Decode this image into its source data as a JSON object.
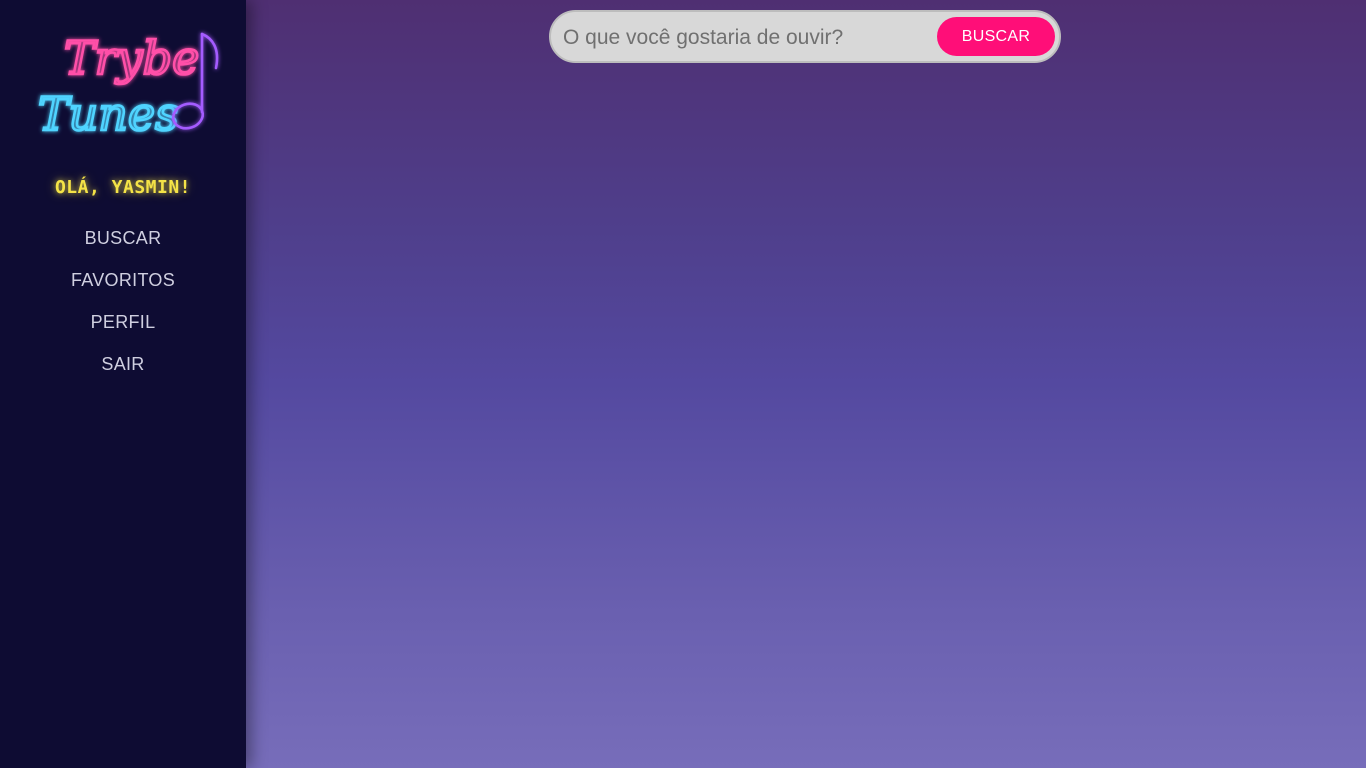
{
  "app": {
    "logo_text_line1": "Trybe",
    "logo_text_line2": "Tunes",
    "logo_colors": {
      "pink": "#ff4fa8",
      "cyan": "#4fd4ff",
      "violet": "#a45bff"
    }
  },
  "sidebar": {
    "greeting": "OLÁ, YASMIN!",
    "items": [
      {
        "label": "BUSCAR"
      },
      {
        "label": "FAVORITOS"
      },
      {
        "label": "PERFIL"
      },
      {
        "label": "SAIR"
      }
    ]
  },
  "search": {
    "placeholder": "O que você gostaria de ouvir?",
    "value": "",
    "button_label": "BUSCAR"
  },
  "colors": {
    "sidebar_bg": "#0e0c33",
    "accent": "#ff0e78",
    "greeting": "#f4e347"
  }
}
